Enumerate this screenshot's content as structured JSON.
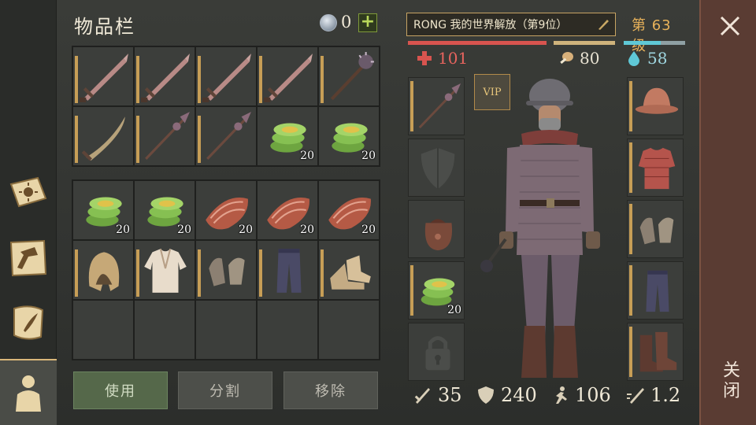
{
  "inventory": {
    "title": "物品栏",
    "currency": "0",
    "rows_top": [
      {
        "icon": "sword-icon",
        "qty": ""
      },
      {
        "icon": "sword-icon",
        "qty": ""
      },
      {
        "icon": "sword-icon",
        "qty": ""
      },
      {
        "icon": "sword-icon",
        "qty": ""
      },
      {
        "icon": "mace-icon",
        "qty": ""
      },
      {
        "icon": "saber-icon",
        "qty": ""
      },
      {
        "icon": "spear-icon",
        "qty": ""
      },
      {
        "icon": "spear-icon",
        "qty": ""
      },
      {
        "icon": "cabbage-icon",
        "qty": "20"
      },
      {
        "icon": "cabbage-icon",
        "qty": "20"
      }
    ],
    "rows_bottom": [
      {
        "icon": "cabbage-icon",
        "qty": "20"
      },
      {
        "icon": "cabbage-icon",
        "qty": "20"
      },
      {
        "icon": "meat-icon",
        "qty": "20"
      },
      {
        "icon": "meat-icon",
        "qty": "20"
      },
      {
        "icon": "meat-icon",
        "qty": "20"
      },
      {
        "icon": "hood-icon",
        "qty": ""
      },
      {
        "icon": "shirt-icon",
        "qty": ""
      },
      {
        "icon": "gloves-icon",
        "qty": ""
      },
      {
        "icon": "pants-icon",
        "qty": ""
      },
      {
        "icon": "shoes-icon",
        "qty": ""
      },
      {
        "icon": "",
        "qty": ""
      },
      {
        "icon": "",
        "qty": ""
      },
      {
        "icon": "",
        "qty": ""
      },
      {
        "icon": "",
        "qty": ""
      },
      {
        "icon": "",
        "qty": ""
      }
    ],
    "buttons": {
      "use": "使用",
      "split": "分割",
      "remove": "移除"
    }
  },
  "character": {
    "name": "RONG 我的世界解放（第9位）",
    "level": "第 63 级",
    "hp": "101",
    "food": "80",
    "water": "58",
    "water_fraction": 0.6,
    "vip": "VIP",
    "left_slots": [
      {
        "icon": "spear-icon",
        "qty": ""
      },
      {
        "icon": "shield-icon",
        "qty": ""
      },
      {
        "icon": "bag-icon",
        "qty": ""
      },
      {
        "icon": "cabbage-icon",
        "qty": "20"
      },
      {
        "icon": "lock-icon",
        "qty": ""
      }
    ],
    "right_slots": [
      {
        "icon": "helmet-icon"
      },
      {
        "icon": "chainmail-icon"
      },
      {
        "icon": "gloves-icon"
      },
      {
        "icon": "pants-icon"
      },
      {
        "icon": "boots-icon"
      }
    ],
    "stats": {
      "attack": "35",
      "armor": "240",
      "speed": "106",
      "attack_speed": "1.2"
    }
  },
  "close": {
    "label": "关闭"
  },
  "colors": {
    "accent": "#c79e56",
    "hp": "#d8544f",
    "water": "#5fc8d6",
    "use_btn": "#55684a"
  }
}
